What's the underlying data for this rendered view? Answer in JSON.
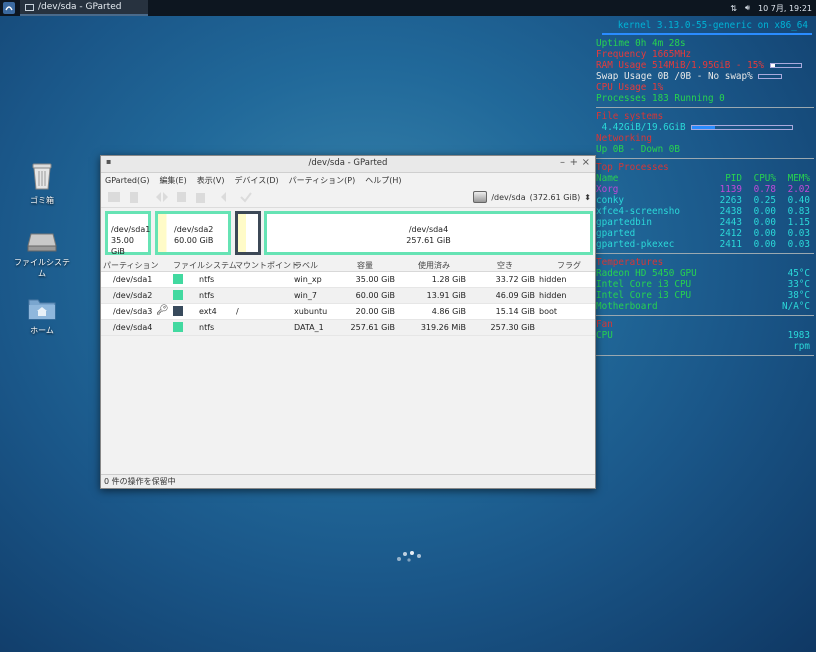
{
  "panel": {
    "window_button": "/dev/sda - GParted",
    "clock": "10 7月, 19:21"
  },
  "desktop": {
    "icons": [
      {
        "label": "ゴミ箱"
      },
      {
        "label": "ファイルシステム"
      },
      {
        "label": "ホーム"
      }
    ]
  },
  "conky": {
    "kernel": "kernel 3.13.0-55-generic on x86_64",
    "uptime": "Uptime  0h 4m 28s",
    "frequency": "Frequency  1665MHz",
    "ram": "RAM Usage  514MiB/1.95GiB - 15%",
    "swap": "Swap Usage  0B  /0B   - No swap%",
    "cpu": "CPU Usage  1%",
    "processes": "Processes  183  Running  0",
    "file_systems_title": "File systems",
    "fs_line": "4.42GiB/19.6GiB",
    "networking_title": "Networking",
    "net_line": "Up  0B   - Down  0B",
    "top_title": "Top Processes",
    "top_header": [
      "Name",
      "PID",
      "CPU%",
      "MEM%"
    ],
    "top_rows": [
      {
        "name": "Xorg",
        "pid": "1139",
        "cpu": "0.78",
        "mem": "2.02"
      },
      {
        "name": "conky",
        "pid": "2263",
        "cpu": "0.25",
        "mem": "0.40"
      },
      {
        "name": "xfce4-screensho",
        "pid": "2438",
        "cpu": "0.00",
        "mem": "0.83"
      },
      {
        "name": "gpartedbin",
        "pid": "2443",
        "cpu": "0.00",
        "mem": "1.15"
      },
      {
        "name": "gparted",
        "pid": "2412",
        "cpu": "0.00",
        "mem": "0.03"
      },
      {
        "name": "gparted-pkexec",
        "pid": "2411",
        "cpu": "0.00",
        "mem": "0.03"
      }
    ],
    "temp_title": "Temperatures",
    "temps": [
      {
        "label": "Radeon HD 5450 GPU",
        "value": "45°C"
      },
      {
        "label": "Intel Core i3 CPU",
        "value": "33°C"
      },
      {
        "label": "Intel Core i3 CPU",
        "value": "38°C"
      },
      {
        "label": "Motherboard",
        "value": "N/A°C"
      }
    ],
    "fan_title": "Fan",
    "fan_label": "CPU",
    "fan_value": "1983 rpm",
    "bars": {
      "ram": 0.15,
      "swap": 0.0,
      "cpu": 0.01,
      "fs": 0.23
    }
  },
  "window": {
    "title": "/dev/sda - GParted",
    "menu": [
      "GParted(G)",
      "編集(E)",
      "表示(V)",
      "デバイス(D)",
      "パーティション(P)",
      "ヘルプ(H)"
    ],
    "device": "/dev/sda",
    "device_size": "(372.61 GiB)",
    "map": [
      {
        "name": "/dev/sda1",
        "size": "35.00 GiB"
      },
      {
        "name": "/dev/sda2",
        "size": "60.00 GiB"
      },
      {
        "name": "",
        "size": ""
      },
      {
        "name": "/dev/sda4",
        "size": "257.61 GiB"
      }
    ],
    "columns": [
      "パーティション",
      "ファイルシステム",
      "マウントポイント",
      "ラベル",
      "容量",
      "使用済み",
      "空き",
      "フラグ"
    ],
    "rows": [
      {
        "partition": "/dev/sda1",
        "fs": "ntfs",
        "mount": "",
        "label": "win_xp",
        "size": "35.00 GiB",
        "used": "1.28 GiB",
        "free": "33.72 GiB",
        "flags": "hidden",
        "color": "#42d9a0"
      },
      {
        "partition": "/dev/sda2",
        "fs": "ntfs",
        "mount": "",
        "label": "win_7",
        "size": "60.00 GiB",
        "used": "13.91 GiB",
        "free": "46.09 GiB",
        "flags": "hidden",
        "color": "#42d9a0"
      },
      {
        "partition": "/dev/sda3",
        "fs": "ext4",
        "mount": "/",
        "label": "xubuntu",
        "size": "20.00 GiB",
        "used": "4.86 GiB",
        "free": "15.14 GiB",
        "flags": "boot",
        "color": "#384a5c"
      },
      {
        "partition": "/dev/sda4",
        "fs": "ntfs",
        "mount": "",
        "label": "DATA_1",
        "size": "257.61 GiB",
        "used": "319.26 MiB",
        "free": "257.30 GiB",
        "flags": "",
        "color": "#42d9a0"
      }
    ],
    "status": "0 件の操作を保留中"
  }
}
